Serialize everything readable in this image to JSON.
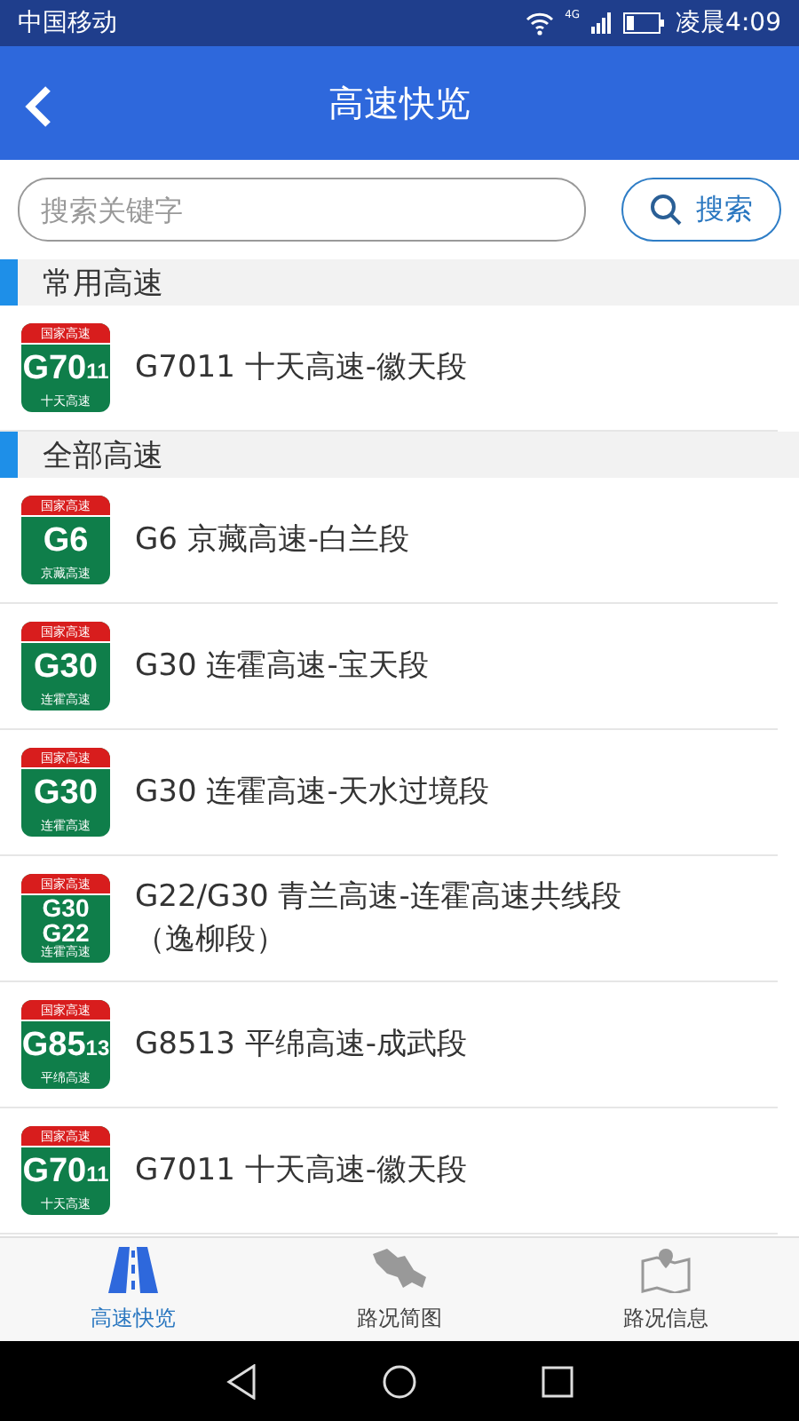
{
  "status_bar": {
    "carrier": "中国移动",
    "network": "4G",
    "time": "凌晨4:09"
  },
  "header": {
    "title": "高速快览"
  },
  "search": {
    "placeholder": "搜索关键字",
    "button": "搜索"
  },
  "sections": [
    {
      "title": "常用高速",
      "items": [
        {
          "shield": {
            "top": "国家高速",
            "lines": [
              {
                "main": "G70",
                "suffix": "11"
              }
            ],
            "bottom": "十天高速"
          },
          "label": "G7011 十天高速-徽天段"
        }
      ]
    },
    {
      "title": "全部高速",
      "items": [
        {
          "shield": {
            "top": "国家高速",
            "lines": [
              {
                "main": "G6"
              }
            ],
            "bottom": "京藏高速"
          },
          "label": "G6 京藏高速-白兰段"
        },
        {
          "shield": {
            "top": "国家高速",
            "lines": [
              {
                "main": "G30"
              }
            ],
            "bottom": "连霍高速"
          },
          "label": "G30 连霍高速-宝天段"
        },
        {
          "shield": {
            "top": "国家高速",
            "lines": [
              {
                "main": "G30"
              }
            ],
            "bottom": "连霍高速"
          },
          "label": "G30 连霍高速-天水过境段"
        },
        {
          "shield": {
            "top": "国家高速",
            "lines": [
              {
                "main": "G30"
              },
              {
                "main": "G22"
              }
            ],
            "bottom": "连霍高速"
          },
          "label": "G22/G30 青兰高速-连霍高速共线段（逸柳段）"
        },
        {
          "shield": {
            "top": "国家高速",
            "lines": [
              {
                "main": "G85",
                "suffix": "13"
              }
            ],
            "bottom": "平绵高速"
          },
          "label": "G8513 平绵高速-成武段"
        },
        {
          "shield": {
            "top": "国家高速",
            "lines": [
              {
                "main": "G70",
                "suffix": "11"
              }
            ],
            "bottom": "十天高速"
          },
          "label": "G7011 十天高速-徽天段"
        }
      ]
    }
  ],
  "tabs": [
    {
      "kind": "road",
      "label": "高速快览",
      "selected": true
    },
    {
      "kind": "map",
      "label": "路况简图",
      "selected": false
    },
    {
      "kind": "info",
      "label": "路况信息",
      "selected": false
    }
  ]
}
